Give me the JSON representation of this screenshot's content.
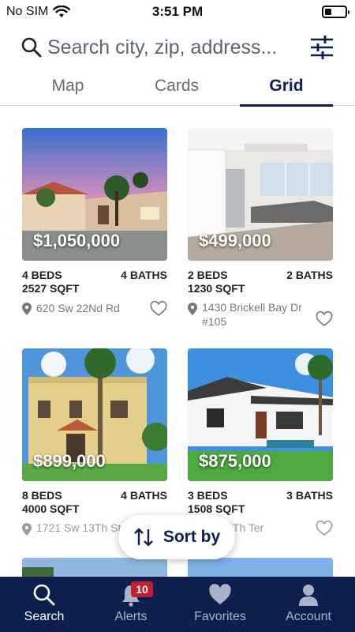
{
  "status_bar": {
    "carrier": "No SIM",
    "time": "3:51 PM",
    "battery_level": 0.35
  },
  "search": {
    "placeholder": "Search city, zip, address..."
  },
  "tabs": [
    {
      "label": "Map",
      "active": false
    },
    {
      "label": "Cards",
      "active": false
    },
    {
      "label": "Grid",
      "active": true
    }
  ],
  "listings": [
    {
      "price": "$1,050,000",
      "beds": "4 BEDS",
      "baths": "4 BATHS",
      "sqft": "2527 SQFT",
      "address": "620 Sw 22Nd Rd"
    },
    {
      "price": "$499,000",
      "beds": "2 BEDS",
      "baths": "2 BATHS",
      "sqft": "1230 SQFT",
      "address": "1430 Brickell Bay Dr #105"
    },
    {
      "price": "$899,000",
      "beds": "8 BEDS",
      "baths": "4 BATHS",
      "sqft": "4000 SQFT",
      "address": "1721 Sw 13Th St"
    },
    {
      "price": "$875,000",
      "beds": "3 BEDS",
      "baths": "3 BATHS",
      "sqft": "1508 SQFT",
      "address": "Sw 14Th Ter"
    }
  ],
  "sort": {
    "label": "Sort by"
  },
  "bottom_nav": [
    {
      "label": "Search",
      "icon": "search-icon",
      "active": true
    },
    {
      "label": "Alerts",
      "icon": "bell-icon",
      "badge": "10",
      "active": false
    },
    {
      "label": "Favorites",
      "icon": "heart-icon",
      "active": false
    },
    {
      "label": "Account",
      "icon": "person-icon",
      "active": false
    }
  ],
  "colors": {
    "brand_navy": "#0f1f4d",
    "badge_red": "#c0202f"
  }
}
